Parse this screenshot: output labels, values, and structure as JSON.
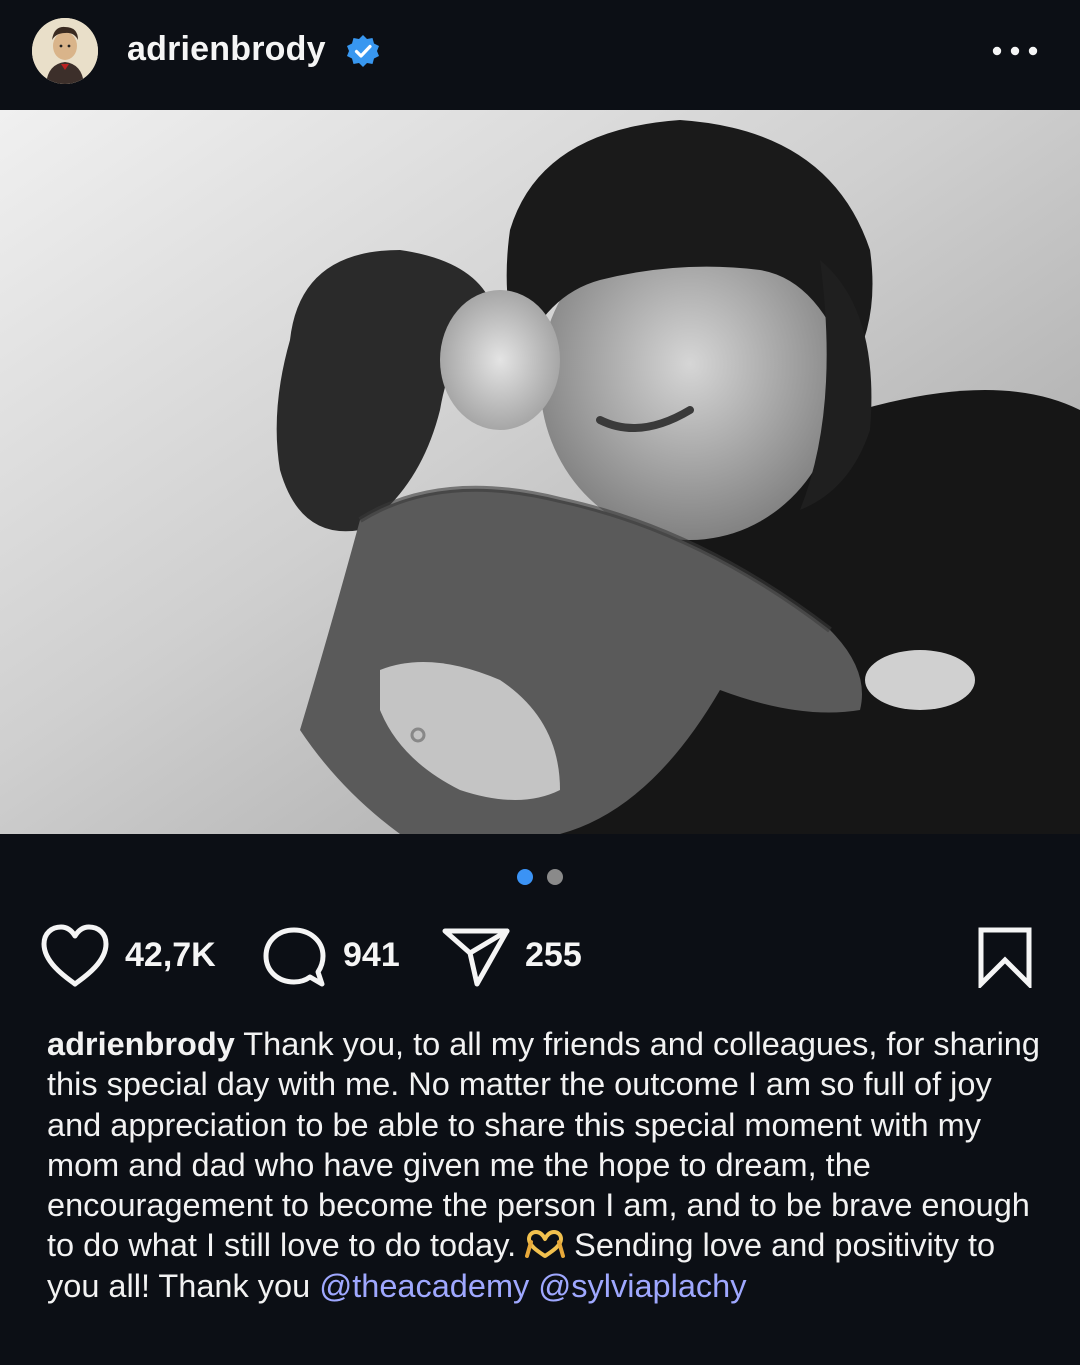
{
  "post": {
    "username": "adrienbrody",
    "verified_badge_color": "#3897f0",
    "more_icon": "more-horizontal-icon"
  },
  "photo": {
    "style": "black-and-white",
    "carousel": {
      "count": 2,
      "active_index": 0,
      "active_color": "#3b93f5",
      "inactive_color": "#8a8a8a"
    }
  },
  "actions": {
    "like_count": "42,7K",
    "comment_count": "941",
    "share_count": "255",
    "icons": [
      "heart-icon",
      "comment-icon",
      "share-icon",
      "bookmark-icon"
    ]
  },
  "caption": {
    "username": "adrienbrody",
    "text_before_emoji": "Thank you, to all my friends and colleagues, for sharing this special day with me. No matter the outcome I am so full of joy and appreciation to be able to share this special moment with my mom and dad who have given me the hope to dream, the encouragement to become the person I am, and to be brave enough to do what I still love to do today.",
    "emoji": "heart-hands-emoji",
    "text_after_emoji": "Sending love and positivity to you all! Thank you",
    "mentions": [
      "@theacademy",
      "@sylviaplachy"
    ],
    "mention_color": "#9fa8ff"
  }
}
